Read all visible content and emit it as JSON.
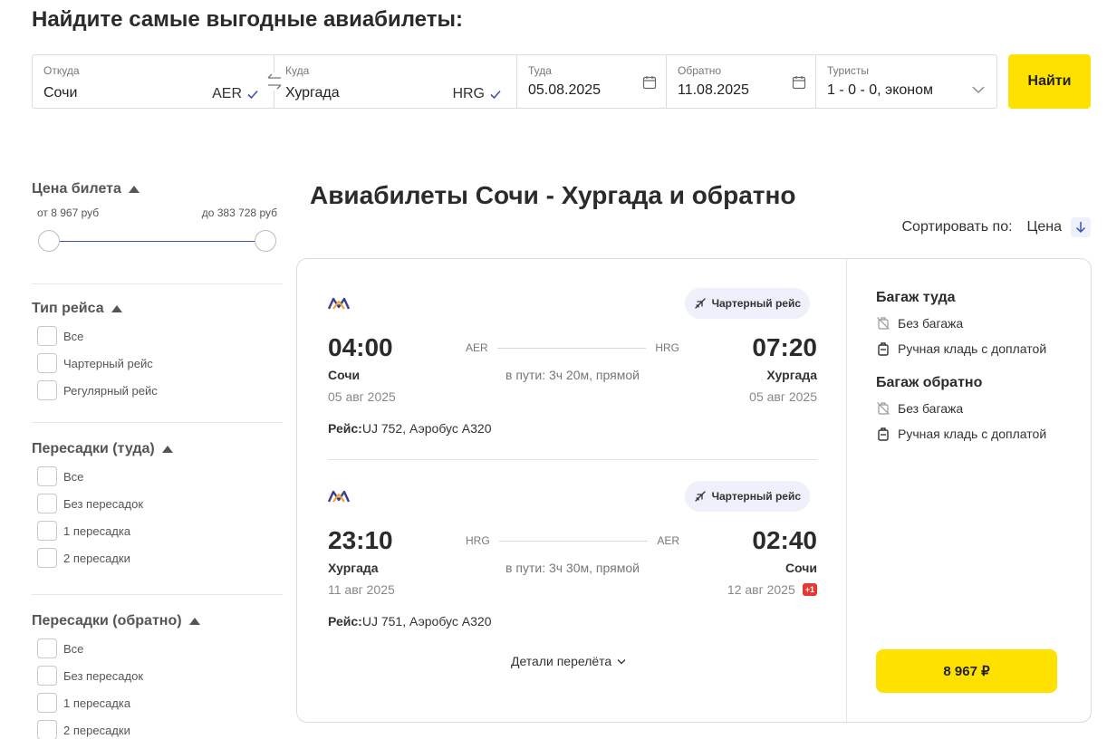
{
  "header": {
    "title": "Найдите самые выгодные авиабилеты:"
  },
  "search": {
    "from": {
      "label": "Откуда",
      "value": "Сочи",
      "code": "AER"
    },
    "to": {
      "label": "Куда",
      "value": "Хургада",
      "code": "HRG"
    },
    "depart": {
      "label": "Туда",
      "value": "05.08.2025"
    },
    "return": {
      "label": "Обратно",
      "value": "11.08.2025"
    },
    "passengers": {
      "label": "Туристы",
      "value": "1 - 0 - 0, эконом"
    },
    "find_label": "Найти"
  },
  "sidebar": {
    "price": {
      "title": "Цена билета",
      "from": "от 8 967 руб",
      "to": "до 383 728 руб"
    },
    "flight_type": {
      "title": "Тип рейса",
      "options": [
        "Все",
        "Чартерный рейс",
        "Регулярный рейс"
      ]
    },
    "stops_out": {
      "title": "Пересадки (туда)",
      "options": [
        "Все",
        "Без пересадок",
        "1 пересадка",
        "2 пересадки"
      ]
    },
    "stops_back": {
      "title": "Пересадки (обратно)",
      "options": [
        "Все",
        "Без пересадок",
        "1 пересадка",
        "2 пересадки"
      ]
    }
  },
  "main": {
    "title": "Авиабилеты Сочи - Хургада и обратно",
    "sort_label": "Сортировать по:",
    "sort_value": "Цена"
  },
  "card": {
    "legs": [
      {
        "badge": "Чартерный рейс",
        "dep_time": "04:00",
        "arr_time": "07:20",
        "dep_code": "AER",
        "arr_code": "HRG",
        "dep_city": "Сочи",
        "arr_city": "Хургада",
        "dep_date": "05 авг 2025",
        "arr_date": "05 авг 2025",
        "duration": "в пути: 3ч 20м, прямой",
        "flight_label": "Рейс:",
        "flight_info": "UJ 752, Аэробус А320"
      },
      {
        "badge": "Чартерный рейс",
        "dep_time": "23:10",
        "arr_time": "02:40",
        "dep_code": "HRG",
        "arr_code": "AER",
        "dep_city": "Хургада",
        "arr_city": "Сочи",
        "dep_date": "11 авг 2025",
        "arr_date": "12 авг 2025",
        "next_day": "+1",
        "duration": "в пути: 3ч 30м, прямой",
        "flight_label": "Рейс:",
        "flight_info": "UJ 751, Аэробус А320"
      }
    ],
    "details_label": "Детали перелёта",
    "baggage": {
      "out_title": "Багаж туда",
      "back_title": "Багаж обратно",
      "no_bag": "Без багажа",
      "hand_bag": "Ручная кладь с доплатой"
    },
    "price": "8 967 ₽"
  },
  "colors": {
    "accent_yellow": "#ffe100",
    "link_blue": "#3f51b5",
    "badge_bg": "#eef0fb",
    "red": "#e53935"
  }
}
